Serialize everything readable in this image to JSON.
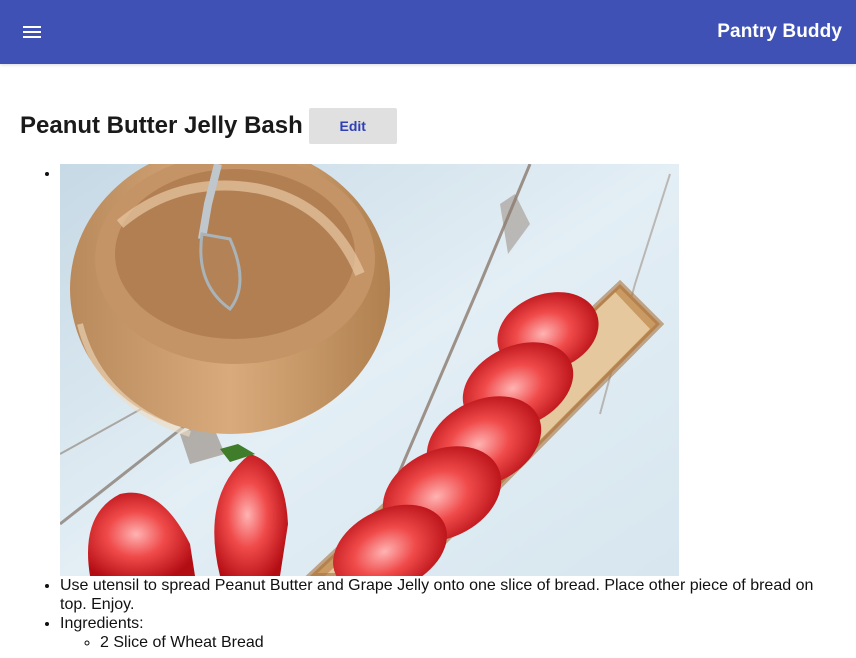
{
  "app": {
    "title": "Pantry Buddy",
    "menu_icon": "menu-icon",
    "bar_color": "#3f51b5"
  },
  "recipe": {
    "title": "Peanut Butter Jelly Bash",
    "edit_label": "Edit",
    "image_alt": "Jar of peanut butter with spoon beside a cracker topped with sliced strawberries",
    "instructions": "Use utensil to spread Peanut Butter and Grape Jelly onto one slice of bread. Place other piece of bread on top. Enjoy.",
    "ingredients_label": "Ingredients:",
    "ingredients": [
      "2 Slice of Wheat Bread"
    ]
  }
}
